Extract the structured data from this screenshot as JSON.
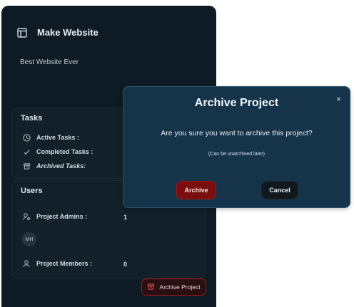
{
  "project": {
    "name": "Make Website",
    "description": "Best Website Ever"
  },
  "tasks": {
    "title": "Tasks",
    "rows": [
      {
        "label": "Active Tasks :",
        "icon": "clock-icon"
      },
      {
        "label": "Completed Tasks :",
        "icon": "check-icon"
      },
      {
        "label": "Archived Tasks:",
        "icon": "archive-box-icon"
      }
    ]
  },
  "users": {
    "title": "Users",
    "admins_label": "Project Admins :",
    "admins_count": "1",
    "avatar_initials": "MH",
    "members_label": "Project Members :",
    "members_count": "0"
  },
  "actions": {
    "archive_project_label": "Archive Project"
  },
  "modal": {
    "title": "Archive Project",
    "close_symbol": "×",
    "question": "Are you sure you want to archive this project?",
    "note": "(Can be unarchived later)",
    "confirm_label": "Archive",
    "cancel_label": "Cancel"
  },
  "colors": {
    "panel_bg": "#0f1b24",
    "modal_bg": "#15344a",
    "danger": "#7a0d0d",
    "danger_border": "#a51616"
  }
}
